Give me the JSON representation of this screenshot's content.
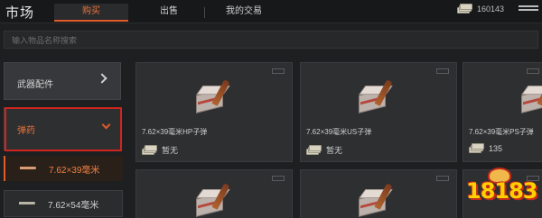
{
  "header": {
    "title": "市场",
    "tabs": [
      {
        "label": "购买",
        "active": true
      },
      {
        "label": "出售",
        "active": false
      },
      {
        "label": "我的交易",
        "active": false
      }
    ],
    "currency_amount": "160143",
    "currency_icon": "cash-stack-icon",
    "menu_icon": "menu-icon"
  },
  "search": {
    "placeholder": "输入物品名称搜索"
  },
  "sidebar": {
    "categories": [
      {
        "label": "武器配件",
        "icon": "chevron-right-icon",
        "expanded": false
      },
      {
        "label": "弹药",
        "icon": "chevron-down-icon",
        "expanded": true
      }
    ],
    "subitems": [
      {
        "label": "7.62×39毫米",
        "selected": true
      },
      {
        "label": "7.62×54毫米",
        "selected": false
      }
    ]
  },
  "items": [
    {
      "name": "7.62×39毫米HP子弹",
      "price": "暂无"
    },
    {
      "name": "7.62×39毫米US子弹",
      "price": "暂无"
    },
    {
      "name": "7.62×39毫米PS子弹",
      "price": "135"
    }
  ],
  "watermark": "18183",
  "colors": {
    "accent": "#e05a2a",
    "highlight_border": "#d0241f",
    "background": "#1e1f21"
  }
}
